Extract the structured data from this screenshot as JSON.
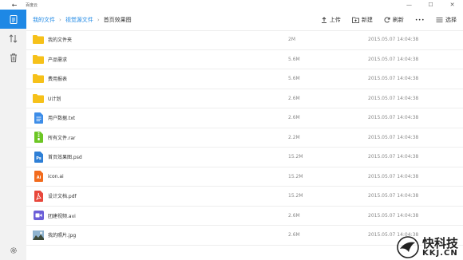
{
  "window": {
    "title": "百度云"
  },
  "breadcrumb": [
    "我的文件",
    "视觉源文件",
    "首页效果图"
  ],
  "toolbar": {
    "upload": "上传",
    "new": "新建",
    "refresh": "刷新",
    "more": "•••",
    "select": "选择"
  },
  "files": [
    {
      "name": "我的文件夹",
      "size": "2M",
      "date": "2015.05.07  14:04:38",
      "icon": "folder-icon"
    },
    {
      "name": "产品需求",
      "size": "5.6M",
      "date": "2015.05.07  14:04:38",
      "icon": "folder-icon"
    },
    {
      "name": "费用报表",
      "size": "5.6M",
      "date": "2015.05.07  14:04:38",
      "icon": "folder-icon"
    },
    {
      "name": "U计划",
      "size": "2.6M",
      "date": "2015.05.07  14:04:38",
      "icon": "folder-icon"
    },
    {
      "name": "用户数据.txt",
      "size": "2.6M",
      "date": "2015.05.07  14:04:38",
      "icon": "txt-file-icon"
    },
    {
      "name": "所有文件.rar",
      "size": "2.2M",
      "date": "2015.05.07  14:04:38",
      "icon": "rar-file-icon"
    },
    {
      "name": "首页效果图.psd",
      "size": "15.2M",
      "date": "2015.05.07  14:04:38",
      "icon": "psd-file-icon"
    },
    {
      "name": "icon.ai",
      "size": "15.2M",
      "date": "2015.05.07  14:04:38",
      "icon": "ai-file-icon"
    },
    {
      "name": "设计文档.pdf",
      "size": "15.2M",
      "date": "2015.05.07  14:04:38",
      "icon": "pdf-file-icon"
    },
    {
      "name": "团建视频.avi",
      "size": "2.6M",
      "date": "2015.05.07  14:04:38",
      "icon": "video-file-icon"
    },
    {
      "name": "我的照片.jpg",
      "size": "2.6M",
      "date": "2015.05.07  14:04:38",
      "icon": "image-file-icon"
    }
  ],
  "watermark": {
    "brand": "快科技",
    "domain": "KKJ.CN"
  },
  "colors": {
    "accent": "#1e88e5",
    "folder": "#f6c11a",
    "sidebar": "#f2f2f2"
  }
}
